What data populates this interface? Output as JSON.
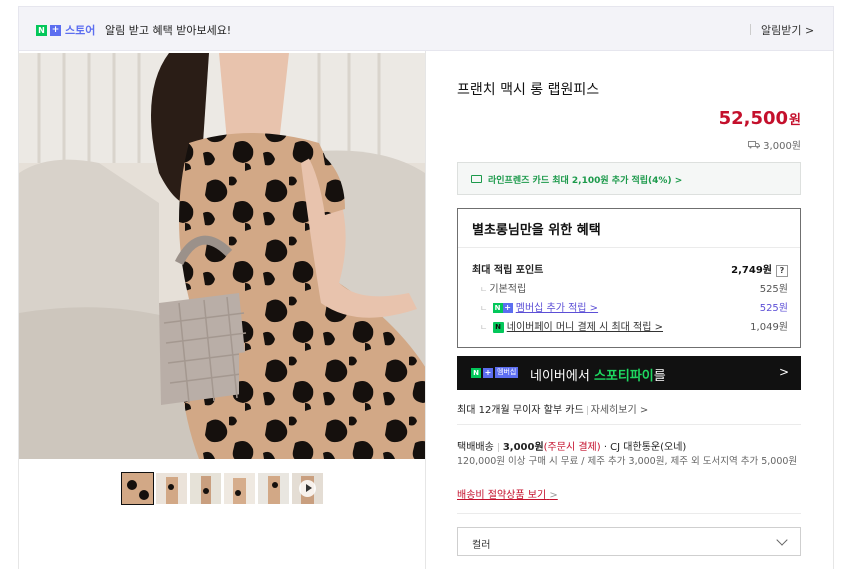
{
  "topbar": {
    "n_badge": "N",
    "plus_badge": "+",
    "store_label": "스토어",
    "message": "알림 받고 혜택 받아보세요!",
    "alert_link": "알림받기 >"
  },
  "product": {
    "title": "프랜치 맥시 롱 랩원피스",
    "price": "52,500",
    "price_unit": "원",
    "shipping_fee": "3,000원"
  },
  "card_banner": {
    "text": "라인프렌즈 카드 최대 2,100원 추가 적립(4%) >"
  },
  "benefit": {
    "heading": "별초롱님만을 위한 혜택",
    "max_points_label": "최대 적립 포인트",
    "max_points_value": "2,749원",
    "help_label": "?",
    "rows": [
      {
        "label": "기본적립",
        "value": "525원"
      },
      {
        "label": "멤버십 추가 적립 >",
        "value": "525원"
      },
      {
        "label": "네이버페이 머니 결제 시 최대 적립 >",
        "value": "1,049원"
      }
    ]
  },
  "spotify": {
    "membership_badge": "멤버십",
    "text_prefix": "네이버에서 ",
    "text_highlight": "스포티파이",
    "text_suffix": "를",
    "arrow": ">"
  },
  "installment": {
    "text": "최대 12개월 무이자 할부 카드",
    "more": "자세히보기 >"
  },
  "delivery": {
    "type": "택배배송",
    "fee": "3,000원",
    "fee_note": "(주문시 결제)",
    "carrier": "· CJ 대한통운(오네)",
    "note": "120,000원 이상 구매 시 무료 / 제주 추가 3,000원, 제주 외 도서지역 추가 5,000원",
    "saving_link": "배송비 절약상품 보기",
    "saving_arrow": ">"
  },
  "option": {
    "label": "컬러"
  },
  "colors": {
    "price_red": "#c4102c",
    "naver_green": "#03c75a",
    "plus_purple": "#5c6ef0",
    "spotify_green": "#1ed760"
  }
}
